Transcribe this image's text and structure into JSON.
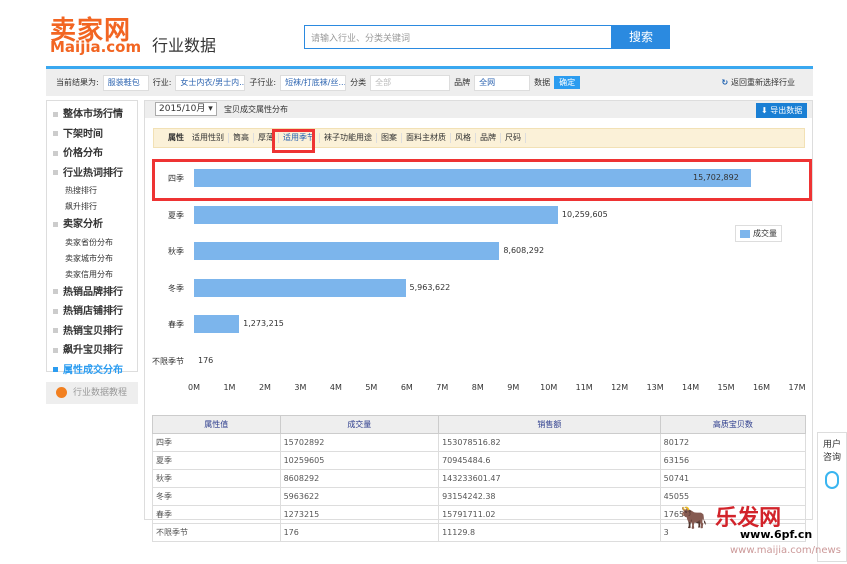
{
  "header": {
    "logo": "卖家网",
    "logo_url": "Maijia.com",
    "subtitle": "行业数据",
    "search_placeholder": "请输入行业、分类关键词",
    "search_btn": "搜索"
  },
  "filters": {
    "label": "当前结果为:",
    "category": "服装鞋包",
    "industry_label": "行业:",
    "industry": "女士内衣/男士内...",
    "sub_label": "子行业:",
    "sub": "短袜/打底袜/丝...",
    "class_label": "分类",
    "class": "全部",
    "brand_label": "品牌",
    "brand": "全网",
    "data_label": "数据",
    "confirm": "确定",
    "back": "返回重新选择行业"
  },
  "sidebar": [
    {
      "label": "整体市场行情",
      "type": "main"
    },
    {
      "label": "下架时间",
      "type": "main"
    },
    {
      "label": "价格分布",
      "type": "main"
    },
    {
      "label": "行业热词排行",
      "type": "main"
    },
    {
      "label": "热搜排行",
      "type": "sub"
    },
    {
      "label": "飙升排行",
      "type": "sub"
    },
    {
      "label": "卖家分析",
      "type": "main"
    },
    {
      "label": "卖家省份分布",
      "type": "sub"
    },
    {
      "label": "卖家城市分布",
      "type": "sub"
    },
    {
      "label": "卖家信用分布",
      "type": "sub"
    },
    {
      "label": "热销品牌排行",
      "type": "main"
    },
    {
      "label": "热销店铺排行",
      "type": "main"
    },
    {
      "label": "热销宝贝排行",
      "type": "main"
    },
    {
      "label": "飙升宝贝排行",
      "type": "main"
    },
    {
      "label": "属性成交分布",
      "type": "active"
    }
  ],
  "tutorial": "行业数据教程",
  "main": {
    "date": "2015/10月",
    "title": "宝贝成交属性分布",
    "export": "导出数据"
  },
  "tabs": [
    "属性",
    "适用性别",
    "筒高",
    "厚薄",
    "适用季节",
    "袜子功能用途",
    "图案",
    "面料主材质",
    "风格",
    "品牌",
    "尺码"
  ],
  "active_tab": 4,
  "chart_data": {
    "type": "bar",
    "orientation": "horizontal",
    "categories": [
      "四季",
      "夏季",
      "秋季",
      "冬季",
      "春季",
      "不限季节"
    ],
    "values": [
      15702892,
      10259605,
      8608292,
      5963622,
      1273215,
      176
    ],
    "labels": [
      "15,702,892",
      "10,259,605",
      "8,608,292",
      "5,963,622",
      "1,273,215",
      "176"
    ],
    "xlim": [
      0,
      17000000
    ],
    "ticks": [
      "0M",
      "1M",
      "2M",
      "3M",
      "4M",
      "5M",
      "6M",
      "7M",
      "8M",
      "9M",
      "10M",
      "11M",
      "12M",
      "13M",
      "14M",
      "15M",
      "16M",
      "17M"
    ],
    "legend": "成交量",
    "legend_position": "right",
    "color": "#7cb5ec"
  },
  "table": {
    "headers": [
      "属性值",
      "成交量",
      "销售额",
      "高质宝贝数"
    ],
    "rows": [
      [
        "四季",
        "15702892",
        "153078516.82",
        "80172"
      ],
      [
        "夏季",
        "10259605",
        "70945484.6",
        "63156"
      ],
      [
        "秋季",
        "8608292",
        "143233601.47",
        "50741"
      ],
      [
        "冬季",
        "5963622",
        "93154242.38",
        "45055"
      ],
      [
        "春季",
        "1273215",
        "15791711.02",
        "17659"
      ],
      [
        "不限季节",
        "176",
        "11129.8",
        "3"
      ]
    ]
  },
  "consult": "用户咨询",
  "watermark": {
    "brand": "乐发网",
    "url": "www.6pf.cn",
    "url2": "www.maijia.com/news"
  }
}
